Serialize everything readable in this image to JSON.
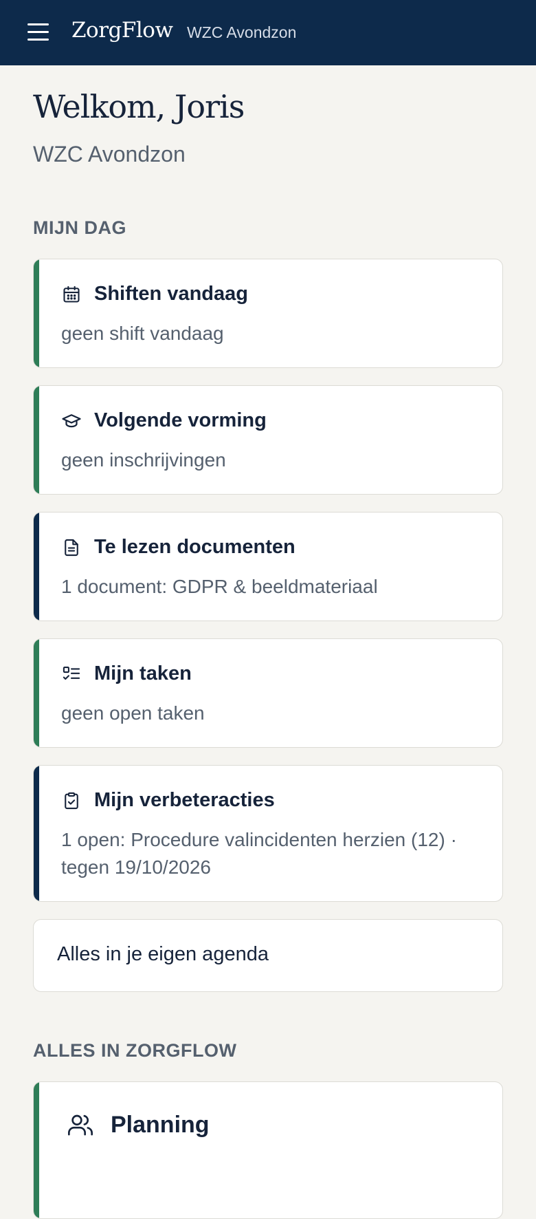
{
  "header": {
    "brand": "ZorgFlow",
    "org_name": "WZC Avondzon",
    "menu_icon": "hamburger-menu-icon"
  },
  "greeting": {
    "title": "Welkom, Joris",
    "subtitle": "WZC Avondzon"
  },
  "my_day": {
    "heading": "MIJN DAG",
    "cards": [
      {
        "title": "Shiften vandaag",
        "detail": "geen shift vandaag",
        "icon": "calendar-icon",
        "accent": "#2e7d57"
      },
      {
        "title": "Volgende vorming",
        "detail": "geen inschrijvingen",
        "icon": "graduation-cap-icon",
        "accent": "#2e7d57"
      },
      {
        "title": "Te lezen documenten",
        "detail": "1 document: GDPR & beeldmateriaal",
        "icon": "document-icon",
        "accent": "#0d2a4b"
      },
      {
        "title": "Mijn taken",
        "detail": "geen open taken",
        "icon": "checklist-icon",
        "accent": "#2e7d57"
      },
      {
        "title": "Mijn verbeteracties",
        "detail": "1 open: Procedure valincidenten herzien (12) · tegen 19/10/2026",
        "icon": "clipboard-check-icon",
        "accent": "#0d2a4b"
      }
    ],
    "agenda_link": "Alles in je eigen agenda"
  },
  "all_in_app": {
    "heading": "ALLES IN ZORGFLOW",
    "cards": [
      {
        "title": "Planning",
        "icon": "users-icon",
        "accent": "#2e7d57"
      }
    ]
  },
  "colors": {
    "header_bg": "#0d2a4b",
    "page_bg": "#f5f4f0",
    "accent_green": "#2e7d57",
    "accent_navy": "#0d2a4b",
    "muted_text": "#55606e"
  }
}
